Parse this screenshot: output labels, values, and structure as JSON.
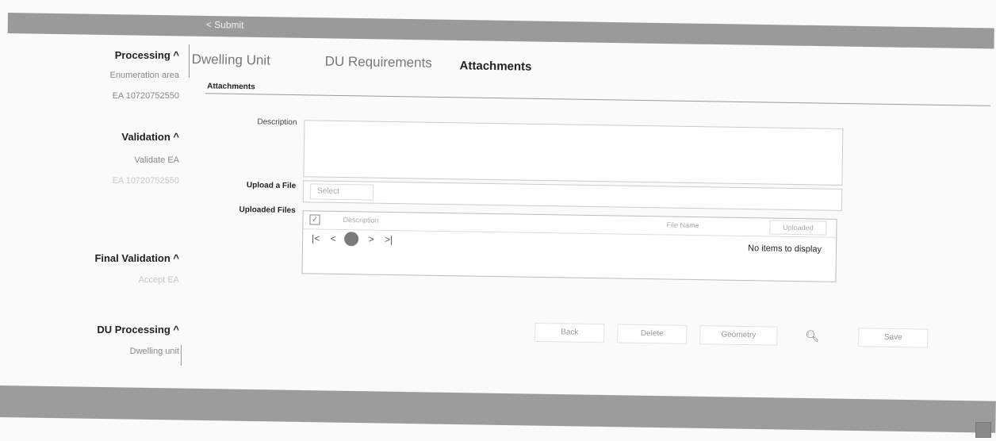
{
  "header": {
    "back_label": "< Submit"
  },
  "sidebar": {
    "sections": [
      {
        "title": "Processing ^",
        "items": [
          "Enumeration area",
          "EA 10720752550"
        ]
      },
      {
        "title": "Validation ^",
        "items": [
          "Validate EA",
          "EA 10720752550"
        ]
      },
      {
        "title": "Final Validation ^",
        "items": [
          "Accept EA"
        ]
      },
      {
        "title": "DU Processing ^",
        "items": [
          "Dwelling unit"
        ]
      }
    ]
  },
  "tabs": [
    {
      "label": "Dwelling Unit"
    },
    {
      "label": "DU Requirements"
    },
    {
      "label": "Attachments"
    }
  ],
  "attachments": {
    "section_label": "Attachments",
    "description_label": "Description",
    "upload_label": "Upload a File",
    "select_label": "Select",
    "uploaded_label": "Uploaded Files",
    "grid_columns": [
      "Description",
      "File Name",
      "Uploaded"
    ],
    "pager": [
      "|<",
      "<",
      "1",
      ">",
      ">|"
    ],
    "empty_text": "No items to display"
  },
  "actions": {
    "back": "Back",
    "delete": "Delete",
    "geometry": "Geometry",
    "save": "Save"
  }
}
